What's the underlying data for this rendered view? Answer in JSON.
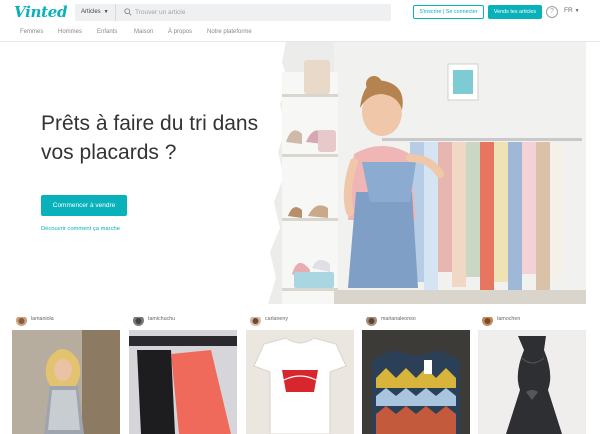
{
  "header": {
    "logo": "Vinted",
    "search_category": "Articles",
    "search_placeholder": "Trouver un article",
    "signup_label": "S'inscrire | Se connecter",
    "sell_label": "Vends tes articles",
    "help_glyph": "?",
    "language": "FR"
  },
  "nav": {
    "items": [
      "Femmes",
      "Hommes",
      "Enfants",
      "Maison",
      "À propos",
      "Notre plateforme"
    ]
  },
  "hero": {
    "title": "Prêts à faire du tri dans vos placards ?",
    "cta_label": "Commencer à vendre",
    "link_label": "Découvrir comment ça marche"
  },
  "feed": {
    "items": [
      {
        "username": "lamaniola"
      },
      {
        "username": "tamichuchu"
      },
      {
        "username": "carlaneny"
      },
      {
        "username": "marianaleonso"
      },
      {
        "username": "tamochen"
      }
    ]
  },
  "colors": {
    "accent": "#09b1ba",
    "text": "#333333",
    "muted": "#888888"
  }
}
